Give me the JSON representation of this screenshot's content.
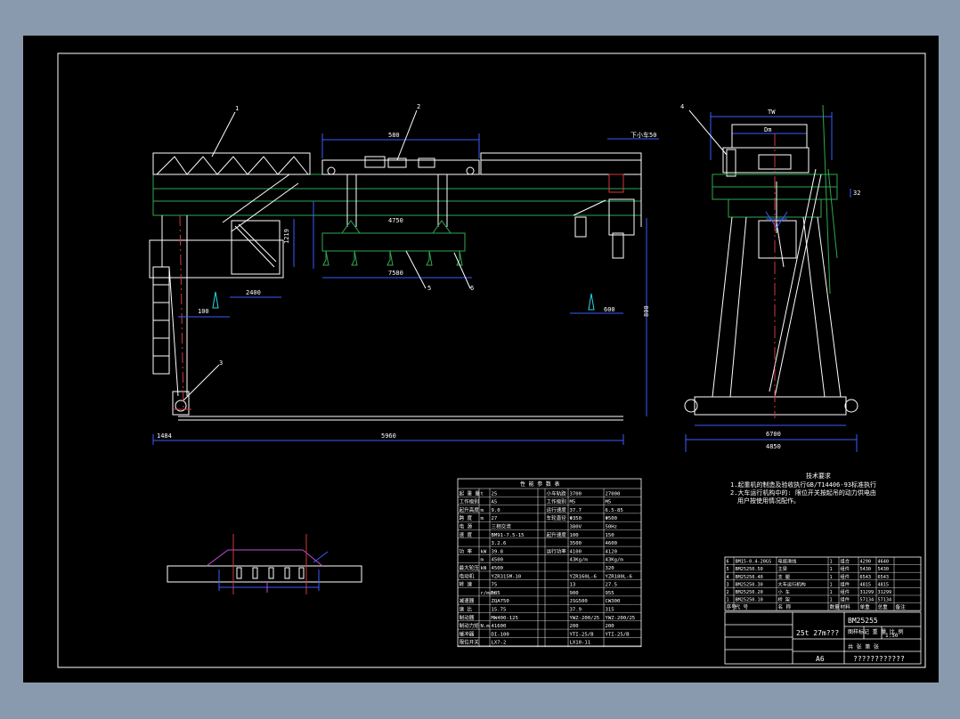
{
  "colors": {
    "frame_bg": "#8a9aae",
    "paper": "#000000",
    "line": "#ffffff",
    "structure": "#2fa84f",
    "center": "#d23a3a",
    "dimension": "#3c5cff",
    "cable": "#8d5cff",
    "highlight": "#c24bd8",
    "cyan": "#29d6e6"
  },
  "callouts": [
    "1",
    "2",
    "3",
    "4",
    "5",
    "6"
  ],
  "dimensions": {
    "span_total": "5960",
    "trolley_width": "580",
    "cantilever": "2400",
    "beam_width": "4750",
    "spreader_len": "7580",
    "lower_left": "1484",
    "left_height_tag": "1219",
    "hook_offset_left": "100",
    "hook_offset_right": "600",
    "right_height": "800",
    "side_top": "TW",
    "side_inner": "Dm",
    "side_base": "6700",
    "side_base2": "4850",
    "side_tick": "32",
    "note_small": "下小车50"
  },
  "notes": {
    "title": "技术要求",
    "line1": "1.起重机的制造及验收执行GB/T14406-93标准执行",
    "line2": "2.大车运行机构中的: 限位开关按起吊的动力供电由",
    "line3": "用户按使用情况配作。"
  },
  "specs": {
    "title": "性 能 参 数 表",
    "rows": [
      [
        "起 重 量",
        "t",
        "25",
        "",
        "小车轨距",
        "3700",
        "27000"
      ],
      [
        "工作级别",
        "",
        "A5",
        "",
        "工作级别",
        "M5",
        "M5"
      ],
      [
        "起升高度",
        "m",
        "9.0",
        "",
        "运行速度",
        "37.7",
        "6.5-85"
      ],
      [
        "跨 度",
        "m",
        "27",
        "",
        "车轮直径",
        "Φ350",
        "Φ500"
      ],
      [
        "电 源",
        "",
        "三相交流",
        "",
        "",
        "380V",
        "50Hz"
      ],
      [
        "速 度",
        "",
        "BM91-7.5-15",
        "",
        "起升速度",
        "100",
        "150"
      ],
      [
        "",
        "",
        "3.2.6",
        "",
        "",
        "3500",
        "4600"
      ],
      [
        "功 率",
        "kW",
        "39.8",
        "",
        "运行功率",
        "4100",
        "4120"
      ],
      [
        "",
        "m",
        "4500",
        "",
        "",
        "43Kg/m",
        "43Kg/m"
      ],
      [
        "最大轮压",
        "kN",
        "4500",
        "",
        "",
        "",
        "320"
      ],
      [
        "电动机",
        "",
        "YZR315M-10",
        "",
        "",
        "YZR160L-6",
        "YZR180L-6"
      ],
      [
        "转 速",
        "",
        "75",
        "",
        "",
        "13",
        "27.5"
      ],
      [
        "",
        "r/min",
        "585",
        "",
        "",
        "900",
        "955"
      ],
      [
        "减速器",
        "",
        "ZQA750",
        "",
        "",
        "JSG500",
        "CW300"
      ],
      [
        "速 比",
        "",
        "15.75",
        "",
        "",
        "37.9",
        "315"
      ],
      [
        "制动器",
        "",
        "MW400-125",
        "",
        "",
        "YWZ-200/25",
        "YWZ-200/25"
      ],
      [
        "制动力矩",
        "N.m",
        "41600",
        "",
        "",
        "200",
        "200"
      ],
      [
        "缓冲器",
        "",
        "DI-100",
        "",
        "",
        "YTI-25/B",
        "YTI-25/B"
      ],
      [
        "限位开关",
        "",
        "LX7-2",
        "",
        "",
        "LX10-11",
        ""
      ]
    ]
  },
  "parts": {
    "rows": [
      [
        "6",
        "BM15-0.4-20GS",
        "电缆滑线",
        "1",
        "组合",
        "4290",
        "4640"
      ],
      [
        "5",
        "BM25250.50",
        "主梁",
        "1",
        "组件",
        "5430",
        "5430"
      ],
      [
        "4",
        "BM25250.40",
        "支 腿",
        "1",
        "组件",
        "6543",
        "6543"
      ],
      [
        "3",
        "BM25250.30",
        "大车运行机构",
        "1",
        "组件",
        "4815",
        "4815"
      ],
      [
        "2",
        "BM25250.20",
        "小 车",
        "1",
        "组件",
        "31299",
        "31299"
      ],
      [
        "1",
        "BM25250.10",
        "桥 架",
        "1",
        "组件",
        "57134",
        "57134"
      ]
    ],
    "header": [
      "序号",
      "代 号",
      "名 称",
      "数量",
      "材料",
      "单重",
      "总重",
      "备注"
    ]
  },
  "title_block": {
    "drawing_no": "BM25255",
    "name": "25t 27m???",
    "subtitle": "图样标记 重 量 比 例",
    "scale": "1:50",
    "mark": "A6",
    "company": "????????????",
    "sheet": "共 张 第 张"
  }
}
